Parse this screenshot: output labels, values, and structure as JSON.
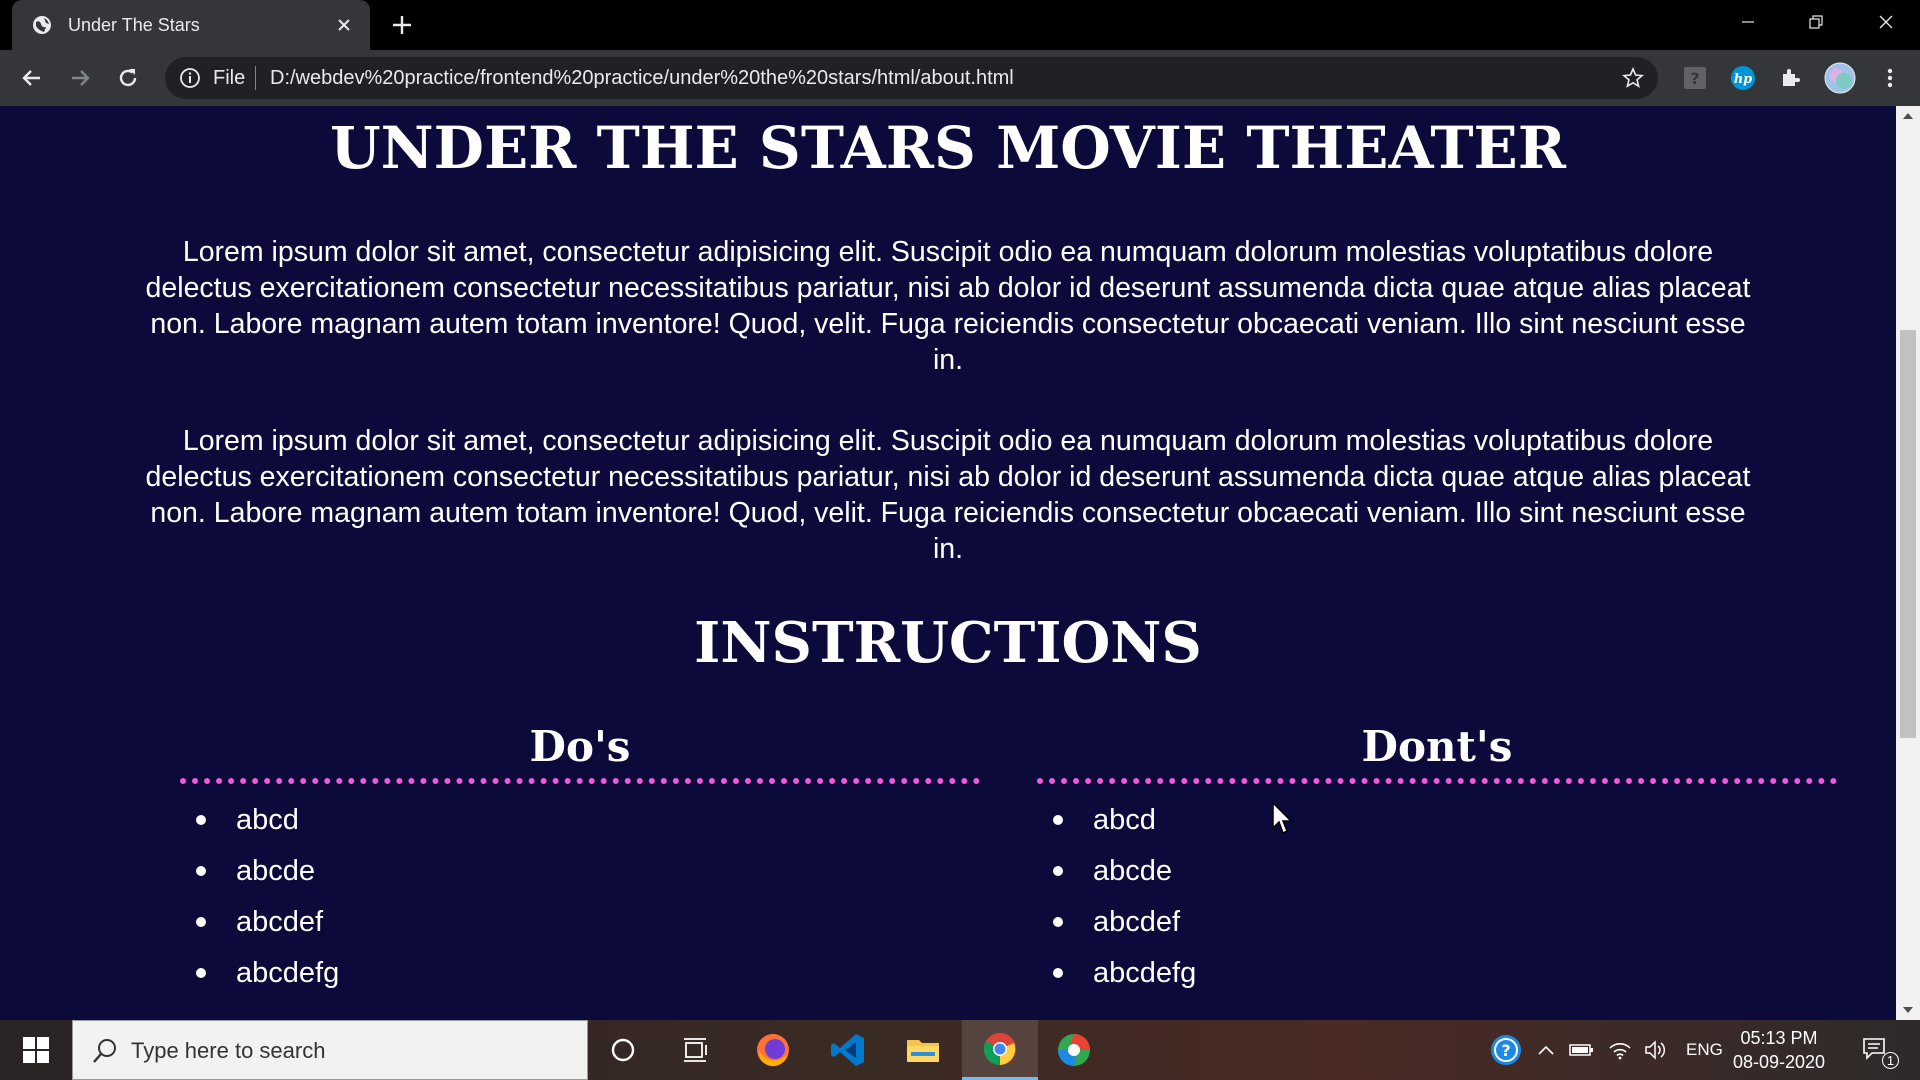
{
  "browser": {
    "tab_title": "Under The Stars",
    "scheme_label": "File",
    "url": "D:/webdev%20practice/frontend%20practice/under%20the%20stars/html/about.html"
  },
  "page": {
    "title": "UNDER THE STARS MOVIE THEATER",
    "paragraphs": [
      "Lorem ipsum dolor sit amet, consectetur adipisicing elit. Suscipit odio ea numquam dolorum molestias voluptatibus dolore delectus exercitationem consectetur necessitatibus pariatur, nisi ab dolor id deserunt assumenda dicta quae atque alias placeat non. Labore magnam autem totam inventore! Quod, velit. Fuga reiciendis consectetur obcaecati veniam. Illo sint nesciunt esse in.",
      "Lorem ipsum dolor sit amet, consectetur adipisicing elit. Suscipit odio ea numquam dolorum molestias voluptatibus dolore delectus exercitationem consectetur necessitatibus pariatur, nisi ab dolor id deserunt assumenda dicta quae atque alias placeat non. Labore magnam autem totam inventore! Quod, velit. Fuga reiciendis consectetur obcaecati veniam. Illo sint nesciunt esse in."
    ],
    "instructions_title": "INSTRUCTIONS",
    "dos": {
      "heading": "Do's",
      "items": [
        "abcd",
        "abcde",
        "abcdef",
        "abcdefg"
      ]
    },
    "donts": {
      "heading": "Dont's",
      "items": [
        "abcd",
        "abcde",
        "abcdef",
        "abcdefg"
      ]
    }
  },
  "taskbar": {
    "search_placeholder": "Type here to search",
    "language": "ENG",
    "time": "05:13 PM",
    "date": "08-09-2020",
    "notification_count": "1"
  },
  "colors": {
    "page_background": "#0b0a3a",
    "divider_accent": "#f05ad8",
    "text": "#ffffff"
  }
}
